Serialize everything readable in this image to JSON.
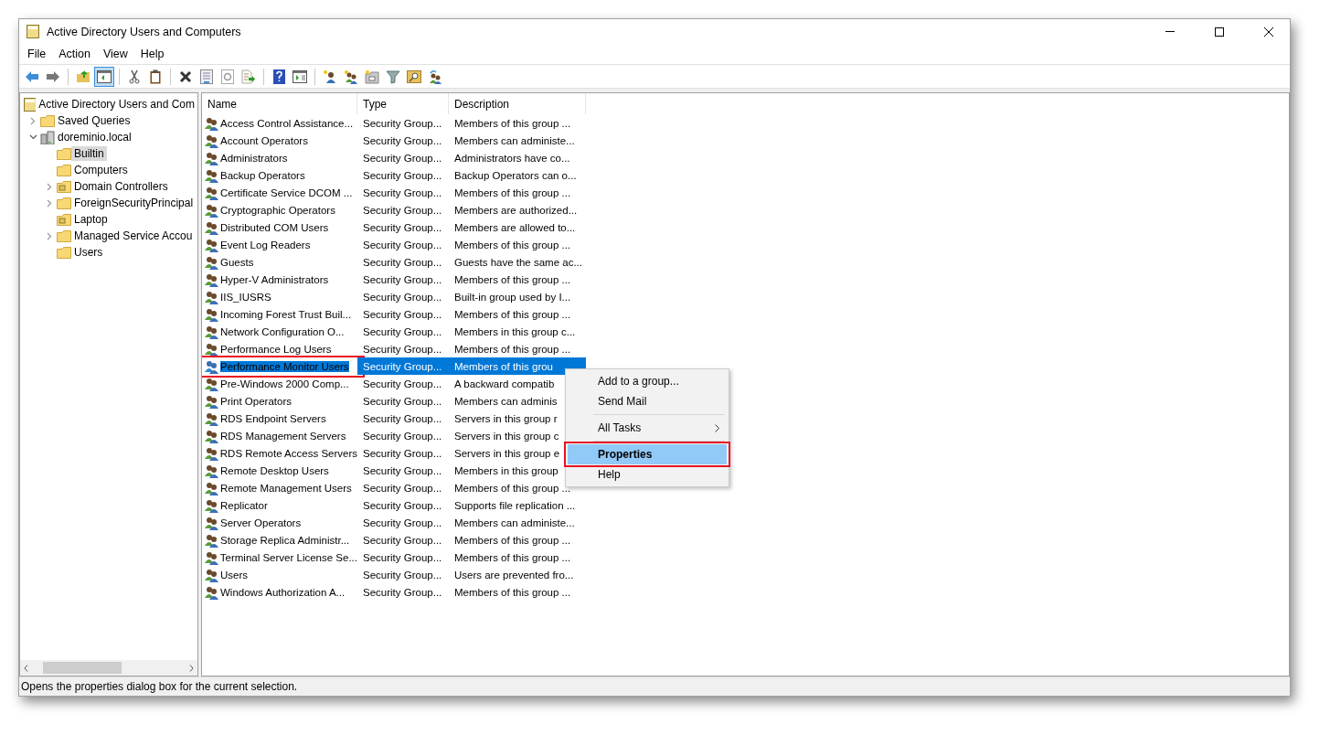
{
  "window": {
    "title": "Active Directory Users and Computers"
  },
  "menu_bar": [
    "File",
    "Action",
    "View",
    "Help"
  ],
  "toolbar": [
    {
      "kind": "back",
      "pressed": false
    },
    {
      "kind": "forward",
      "pressed": false
    },
    {
      "kind": "sep"
    },
    {
      "kind": "up",
      "pressed": false
    },
    {
      "kind": "tree",
      "pressed": true
    },
    {
      "kind": "sep"
    },
    {
      "kind": "cut",
      "pressed": false
    },
    {
      "kind": "paste",
      "pressed": false
    },
    {
      "kind": "sep"
    },
    {
      "kind": "delete",
      "pressed": false
    },
    {
      "kind": "props",
      "pressed": false
    },
    {
      "kind": "refresh",
      "pressed": false
    },
    {
      "kind": "export",
      "pressed": false
    },
    {
      "kind": "sep"
    },
    {
      "kind": "help",
      "pressed": false
    },
    {
      "kind": "pane",
      "pressed": false
    },
    {
      "kind": "sep"
    },
    {
      "kind": "user",
      "pressed": false
    },
    {
      "kind": "group",
      "pressed": false
    },
    {
      "kind": "ou",
      "pressed": false
    },
    {
      "kind": "filter",
      "pressed": false
    },
    {
      "kind": "find",
      "pressed": false
    },
    {
      "kind": "addgroup",
      "pressed": false
    }
  ],
  "tree": [
    {
      "label": "Active Directory Users and Com",
      "kind": "root",
      "selected": false,
      "children": [
        {
          "label": "Saved Queries",
          "kind": "folder",
          "expanded": false,
          "selected": false
        },
        {
          "label": "doreminio.local",
          "kind": "domain",
          "expanded": true,
          "selected": false,
          "children": [
            {
              "label": "Builtin",
              "kind": "folder",
              "selected": true
            },
            {
              "label": "Computers",
              "kind": "folder",
              "selected": false
            },
            {
              "label": "Domain Controllers",
              "kind": "ou",
              "expanded": false,
              "selected": false
            },
            {
              "label": "ForeignSecurityPrincipal",
              "kind": "folder",
              "expanded": false,
              "selected": false
            },
            {
              "label": "Laptop",
              "kind": "ou",
              "selected": false
            },
            {
              "label": "Managed Service Accou",
              "kind": "folder",
              "expanded": false,
              "selected": false
            },
            {
              "label": "Users",
              "kind": "folder",
              "selected": false
            }
          ]
        }
      ]
    }
  ],
  "table": {
    "columns": [
      "Name",
      "Type",
      "Description"
    ],
    "rows": [
      {
        "name": "Access Control Assistance...",
        "type": "Security Group...",
        "description": "Members of this group ...",
        "selected": false,
        "annotated": false
      },
      {
        "name": "Account Operators",
        "type": "Security Group...",
        "description": "Members can administe...",
        "selected": false,
        "annotated": false
      },
      {
        "name": "Administrators",
        "type": "Security Group...",
        "description": "Administrators have co...",
        "selected": false,
        "annotated": false
      },
      {
        "name": "Backup Operators",
        "type": "Security Group...",
        "description": "Backup Operators can o...",
        "selected": false,
        "annotated": false
      },
      {
        "name": "Certificate Service DCOM ...",
        "type": "Security Group...",
        "description": "Members of this group ...",
        "selected": false,
        "annotated": false
      },
      {
        "name": "Cryptographic Operators",
        "type": "Security Group...",
        "description": "Members are authorized...",
        "selected": false,
        "annotated": false
      },
      {
        "name": "Distributed COM Users",
        "type": "Security Group...",
        "description": "Members are allowed to...",
        "selected": false,
        "annotated": false
      },
      {
        "name": "Event Log Readers",
        "type": "Security Group...",
        "description": "Members of this group ...",
        "selected": false,
        "annotated": false
      },
      {
        "name": "Guests",
        "type": "Security Group...",
        "description": "Guests have the same ac...",
        "selected": false,
        "annotated": false
      },
      {
        "name": "Hyper-V Administrators",
        "type": "Security Group...",
        "description": "Members of this group ...",
        "selected": false,
        "annotated": false
      },
      {
        "name": "IIS_IUSRS",
        "type": "Security Group...",
        "description": "Built-in group used by I...",
        "selected": false,
        "annotated": false
      },
      {
        "name": "Incoming Forest Trust Buil...",
        "type": "Security Group...",
        "description": "Members of this group ...",
        "selected": false,
        "annotated": false
      },
      {
        "name": "Network Configuration O...",
        "type": "Security Group...",
        "description": "Members in this group c...",
        "selected": false,
        "annotated": false
      },
      {
        "name": "Performance Log Users",
        "type": "Security Group...",
        "description": "Members of this group ...",
        "selected": false,
        "annotated": false
      },
      {
        "name": "Performance Monitor Users",
        "type": "Security Group...",
        "description": "Members of this grou",
        "selected": true,
        "annotated": true
      },
      {
        "name": "Pre-Windows 2000 Comp...",
        "type": "Security Group...",
        "description": "A backward compatib",
        "selected": false,
        "annotated": false
      },
      {
        "name": "Print Operators",
        "type": "Security Group...",
        "description": "Members can adminis",
        "selected": false,
        "annotated": false
      },
      {
        "name": "RDS Endpoint Servers",
        "type": "Security Group...",
        "description": "Servers in this group r",
        "selected": false,
        "annotated": false
      },
      {
        "name": "RDS Management Servers",
        "type": "Security Group...",
        "description": "Servers in this group c",
        "selected": false,
        "annotated": false
      },
      {
        "name": "RDS Remote Access Servers",
        "type": "Security Group...",
        "description": "Servers in this group e",
        "selected": false,
        "annotated": false
      },
      {
        "name": "Remote Desktop Users",
        "type": "Security Group...",
        "description": "Members in this group",
        "selected": false,
        "annotated": false
      },
      {
        "name": "Remote Management Users",
        "type": "Security Group...",
        "description": "Members of this group ...",
        "selected": false,
        "annotated": false
      },
      {
        "name": "Replicator",
        "type": "Security Group...",
        "description": "Supports file replication ...",
        "selected": false,
        "annotated": false
      },
      {
        "name": "Server Operators",
        "type": "Security Group...",
        "description": "Members can administe...",
        "selected": false,
        "annotated": false
      },
      {
        "name": "Storage Replica Administr...",
        "type": "Security Group...",
        "description": "Members of this group ...",
        "selected": false,
        "annotated": false
      },
      {
        "name": "Terminal Server License Se...",
        "type": "Security Group...",
        "description": "Members of this group ...",
        "selected": false,
        "annotated": false
      },
      {
        "name": "Users",
        "type": "Security Group...",
        "description": "Users are prevented fro...",
        "selected": false,
        "annotated": false
      },
      {
        "name": "Windows Authorization A...",
        "type": "Security Group...",
        "description": "Members of this group ...",
        "selected": false,
        "annotated": false
      }
    ]
  },
  "context_menu": [
    {
      "kind": "item",
      "label": "Add to a group...",
      "selected": false,
      "bold": false,
      "submenu": false,
      "annotated": false
    },
    {
      "kind": "item",
      "label": "Send Mail",
      "selected": false,
      "bold": false,
      "submenu": false,
      "annotated": false
    },
    {
      "kind": "separator"
    },
    {
      "kind": "item",
      "label": "All Tasks",
      "selected": false,
      "bold": false,
      "submenu": true,
      "annotated": false
    },
    {
      "kind": "separator"
    },
    {
      "kind": "item",
      "label": "Properties",
      "selected": true,
      "bold": true,
      "submenu": false,
      "annotated": true
    },
    {
      "kind": "item",
      "label": "Help",
      "selected": false,
      "bold": false,
      "submenu": false,
      "annotated": false
    }
  ],
  "status_bar": "Opens the properties dialog box for the current selection."
}
